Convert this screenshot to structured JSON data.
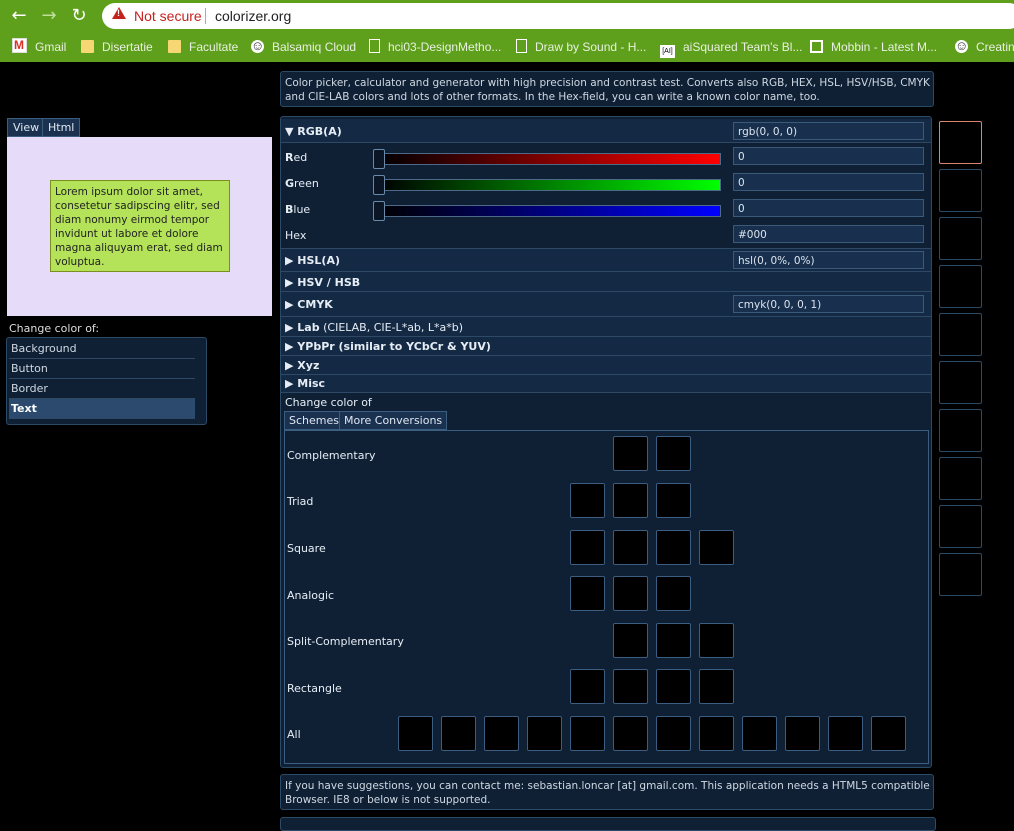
{
  "browser": {
    "not_secure": "Not secure",
    "url": "colorizer.org",
    "bookmarks": [
      {
        "label": "Gmail",
        "icon": "gmail-icon"
      },
      {
        "label": "Disertatie",
        "icon": "folder-icon"
      },
      {
        "label": "Facultate",
        "icon": "folder-icon"
      },
      {
        "label": "Balsamiq Cloud",
        "icon": "smiley-icon"
      },
      {
        "label": "hci03-DesignMetho...",
        "icon": "document-icon"
      },
      {
        "label": "Draw by Sound - H...",
        "icon": "document-icon"
      },
      {
        "label": "aiSquared Team's Bl...",
        "icon": "ai-icon"
      },
      {
        "label": "Mobbin - Latest M...",
        "icon": "mobbin-icon"
      },
      {
        "label": "Creatin",
        "icon": "smiley-icon"
      }
    ]
  },
  "intro": "Color picker, calculator and generator with high precision and contrast test. Converts also RGB, HEX, HSL, HSV/HSB, CMYK and CIE-LAB colors and lots of other formats. In the Hex-field, you can write a known color name, too.",
  "preview": {
    "tabs": [
      "View",
      "Html"
    ],
    "sample_text": "Lorem ipsum dolor sit amet, consetetur sadipscing elitr, sed diam nonumy eirmod tempor invidunt ut labore et dolore magna aliquyam erat, sed diam voluptua.",
    "background_color": "#e6dcfa",
    "button_color": "#b4e35a"
  },
  "change_color_of": {
    "label": "Change color of:",
    "items": [
      "Background",
      "Button",
      "Border",
      "Text"
    ],
    "selected": "Text"
  },
  "rgb": {
    "header": "RGB(A)",
    "value": "rgb(0, 0, 0)",
    "red_first": "R",
    "red_rest": "ed",
    "red_value": "0",
    "green_first": "G",
    "green_rest": "reen",
    "green_value": "0",
    "blue_first": "B",
    "blue_rest": "lue",
    "blue_value": "0",
    "hex_label": "Hex",
    "hex_value": "#000"
  },
  "sections": {
    "hsl": {
      "header": "HSL(A)",
      "value": "hsl(0, 0%, 0%)"
    },
    "hsv": {
      "header": "HSV / HSB"
    },
    "cmyk": {
      "header": "CMYK",
      "value": "cmyk(0, 0, 0, 1)"
    },
    "lab": {
      "header": "Lab",
      "sub": " (CIELAB, CIE-L*ab, L*a*b)"
    },
    "ypbpr": {
      "header": "YPbPr (similar to YCbCr & YUV)"
    },
    "xyz": {
      "header": "Xyz"
    },
    "misc": {
      "header": "Misc"
    }
  },
  "schemes": {
    "label": "Change color of",
    "tabs": [
      "Schemes",
      "More Conversions"
    ],
    "rows": [
      "Complementary",
      "Triad",
      "Square",
      "Analogic",
      "Split-Complementary",
      "Rectangle",
      "All"
    ]
  },
  "footer": "If you have suggestions, you can contact me: sebastian.loncar [at] gmail.com. This application needs a HTML5 compatible Browser. IE8 or below is not supported.",
  "colors": {
    "chrome": "#5e9f1b",
    "panel": "#0f2035",
    "panel_border": "#2b4a66",
    "warning": "#c5221f"
  }
}
